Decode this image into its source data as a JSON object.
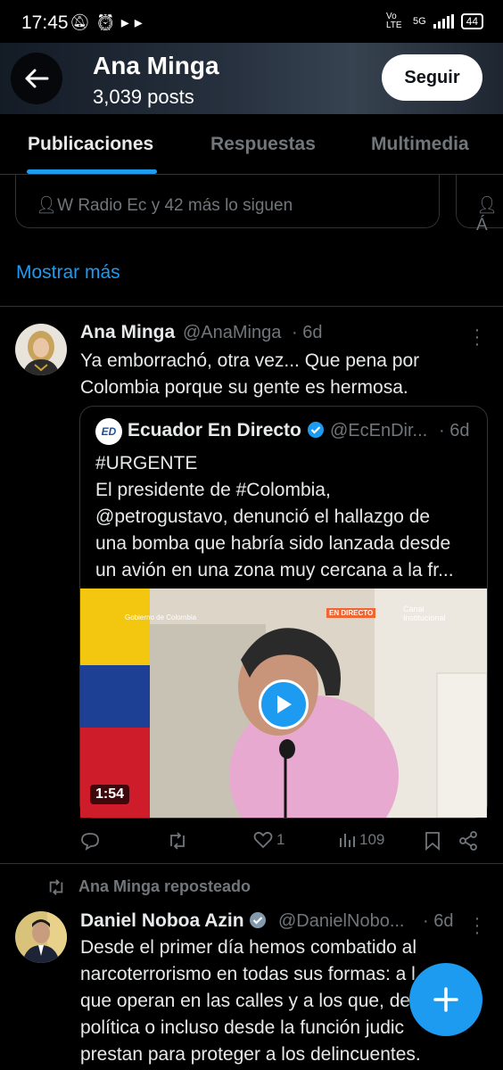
{
  "status_bar": {
    "time": "17:45",
    "network": "Vo LTE",
    "net_gen": "5G",
    "battery": "44"
  },
  "header": {
    "name": "Ana Minga",
    "post_count": "3,039 posts",
    "follow_label": "Seguir"
  },
  "tabs": [
    {
      "label": "Publicaciones",
      "active": true
    },
    {
      "label": "Respuestas",
      "active": false
    },
    {
      "label": "Multimedia",
      "active": false
    }
  ],
  "suggestions": {
    "card1_followers": "W Radio Ec y 42 más lo siguen",
    "card2_followers": "Á",
    "show_more": "Mostrar más"
  },
  "tweet1": {
    "name": "Ana Minga",
    "handle": "@AnaMinga",
    "time": "· 6d",
    "text_line1": "Ya emborrachó, otra vez... Que pena por",
    "text_line2": "Colombia porque su gente es hermosa.",
    "quote": {
      "logo_text": "ED",
      "name": "Ecuador En Directo",
      "verified": true,
      "handle": "@EcEnDir...",
      "time": "· 6d",
      "line1": "#URGENTE",
      "line2": "El presidente de #Colombia,",
      "line3": "@petrogustavo, denunció el hallazgo de",
      "line4": "una bomba que habría sido lanzada desde",
      "line5": "un avión en una zona muy cercana a la fr...",
      "video_duration": "1:54",
      "video_overlay_left": "Gobierno de Colombia",
      "video_overlay_badge": "EN DIRECTO",
      "video_overlay_channel": "Canal Institucional"
    },
    "likes": "1",
    "views": "109"
  },
  "repost": {
    "label": "Ana Minga reposteado"
  },
  "tweet2": {
    "name": "Daniel Noboa Azin",
    "verified": true,
    "handle": "@DanielNobo...",
    "time": "· 6d",
    "line1": "Desde el primer día hemos combatido al",
    "line2": "narcoterrorismo en todas sus formas: a l",
    "line3": "que operan en las calles y a los que, de",
    "line4": "política o incluso desde la función judic",
    "line5": "prestan para proteger a los delincuentes."
  },
  "colors": {
    "accent": "#1d9bf0",
    "background": "#000000",
    "secondary_text": "#71767b",
    "border": "#2f3336"
  }
}
